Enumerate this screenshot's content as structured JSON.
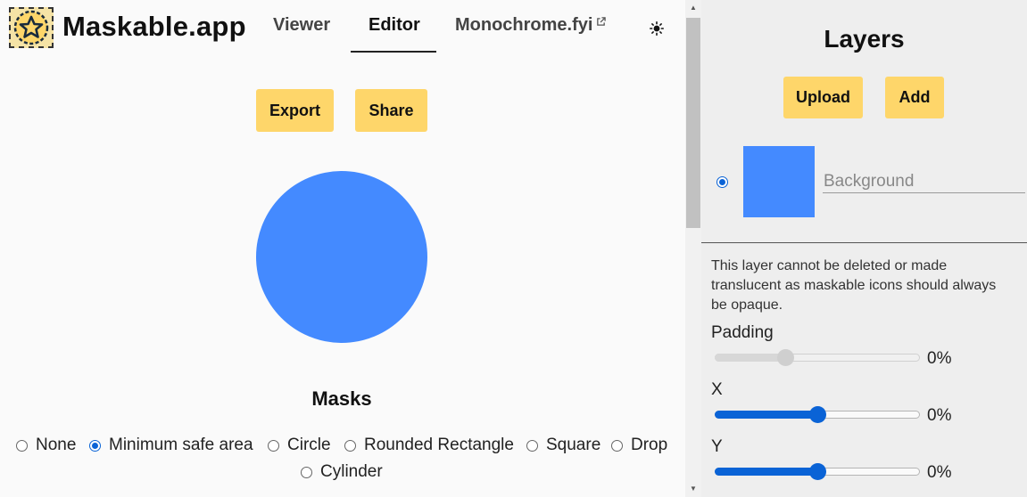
{
  "header": {
    "app_title": "Maskable.app",
    "tabs": [
      {
        "label": "Viewer",
        "active": false
      },
      {
        "label": "Editor",
        "active": true
      },
      {
        "label": "Monochrome.fyi",
        "active": false,
        "icon": "external-link-icon"
      }
    ],
    "theme_toggle_icon": "sun-icon"
  },
  "editor": {
    "export_label": "Export",
    "share_label": "Share",
    "preview_color": "#448aff",
    "masks_title": "Masks",
    "masks": [
      {
        "label": "None",
        "checked": false
      },
      {
        "label": "Minimum safe area",
        "checked": true
      },
      {
        "label": "Circle",
        "checked": false
      },
      {
        "label": "Rounded Rectangle",
        "checked": false
      },
      {
        "label": "Square",
        "checked": false
      },
      {
        "label": "Drop",
        "checked": false
      },
      {
        "label": "Cylinder",
        "checked": false
      }
    ]
  },
  "layers": {
    "title": "Layers",
    "upload_label": "Upload",
    "add_label": "Add",
    "items": [
      {
        "name_placeholder": "Background",
        "color": "#448aff",
        "selected": true
      }
    ],
    "note": "This layer cannot be deleted or made translucent as maskable icons should always be opaque.",
    "controls": [
      {
        "label": "Padding",
        "value_text": "0%",
        "level": 0.34,
        "disabled": true
      },
      {
        "label": "X",
        "value_text": "0%",
        "level": 0.5,
        "disabled": false
      },
      {
        "label": "Y",
        "value_text": "0%",
        "level": 0.5,
        "disabled": false
      }
    ]
  },
  "colors": {
    "accent": "#fed66a",
    "brand_blue": "#448aff",
    "control_blue": "#0a63d6"
  }
}
